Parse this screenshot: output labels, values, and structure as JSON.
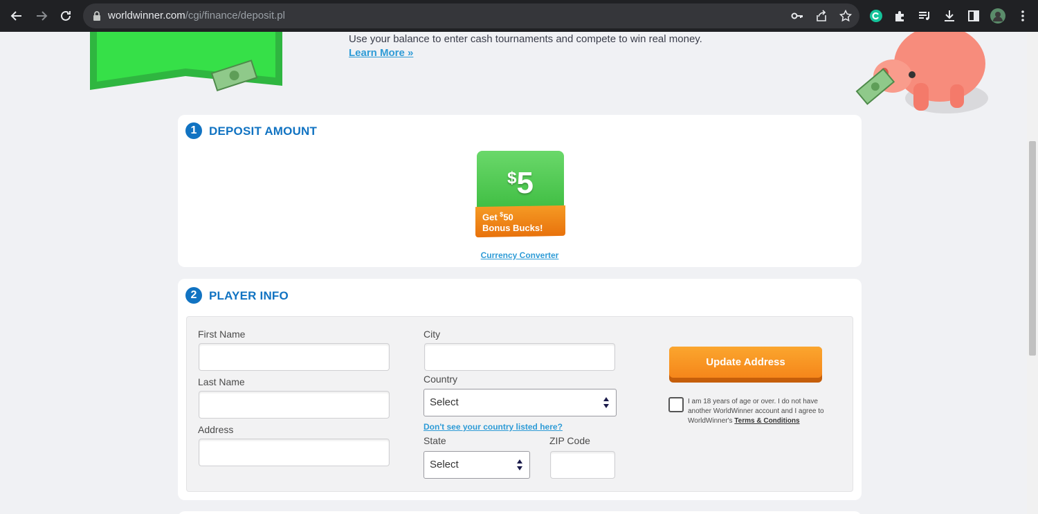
{
  "browser": {
    "url_host": "worldwinner.com",
    "url_path": "/cgi/finance/deposit.pl"
  },
  "header": {
    "promo_text": "Use your balance to enter cash tournaments and compete to win real money.",
    "learn_more": "Learn More »"
  },
  "deposit": {
    "step_number": "1",
    "title": "DEPOSIT AMOUNT",
    "amount_currency": "$",
    "amount_value": "5",
    "bonus_prefix": "Get ",
    "bonus_currency": "$",
    "bonus_value": "50",
    "bonus_suffix": "Bonus Bucks!",
    "currency_converter": "Currency Converter"
  },
  "player_info": {
    "step_number": "2",
    "title": "PLAYER INFO",
    "first_name_label": "First Name",
    "last_name_label": "Last Name",
    "address_label": "Address",
    "city_label": "City",
    "country_label": "Country",
    "country_value": "Select",
    "country_missing_link": "Don't see your country listed here?",
    "state_label": "State",
    "state_value": "Select",
    "zip_label": "ZIP Code",
    "update_button": "Update Address",
    "terms_text": "I am 18 years of age or over. I do not have another WorldWinner account and I agree to WorldWinner's ",
    "terms_link": "Terms & Conditions"
  },
  "colors": {
    "accent_blue": "#1173c2",
    "link_blue": "#2e9bd6",
    "button_orange": "#f5861a",
    "tile_green": "#38b93c"
  }
}
